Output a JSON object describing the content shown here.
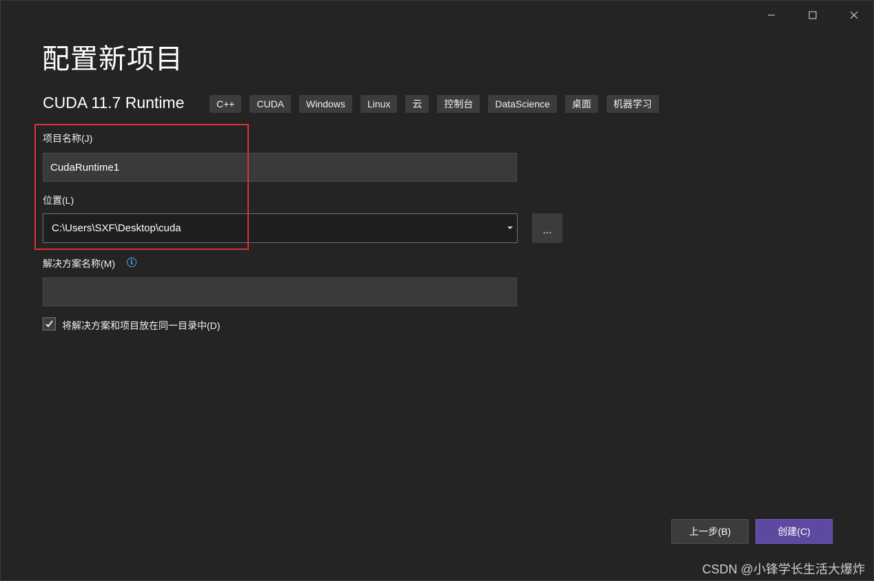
{
  "window": {
    "title": "配置新项目",
    "controls": {
      "minimize_icon": "minimize-icon",
      "maximize_icon": "maximize-icon",
      "close_icon": "close-icon"
    }
  },
  "template": {
    "name": "CUDA 11.7 Runtime",
    "tags": [
      "C++",
      "CUDA",
      "Windows",
      "Linux",
      "云",
      "控制台",
      "DataScience",
      "桌面",
      "机器学习"
    ]
  },
  "form": {
    "project_name_label": "项目名称(J)",
    "project_name_value": "CudaRuntime1",
    "location_label": "位置(L)",
    "location_value": "C:\\Users\\SXF\\Desktop\\cuda",
    "browse_label": "...",
    "solution_name_label": "解决方案名称(M)",
    "solution_name_value": "",
    "same_dir_checkbox_label": "将解决方案和项目放在同一目录中(D)",
    "same_dir_checked": true
  },
  "footer": {
    "back_label": "上一步(B)",
    "create_label": "创建(C)"
  },
  "watermark": "CSDN @小锋学长生活大爆炸",
  "colors": {
    "accent": "#5d4aa0",
    "highlight_border": "#e03131",
    "info": "#4fa3e8"
  }
}
